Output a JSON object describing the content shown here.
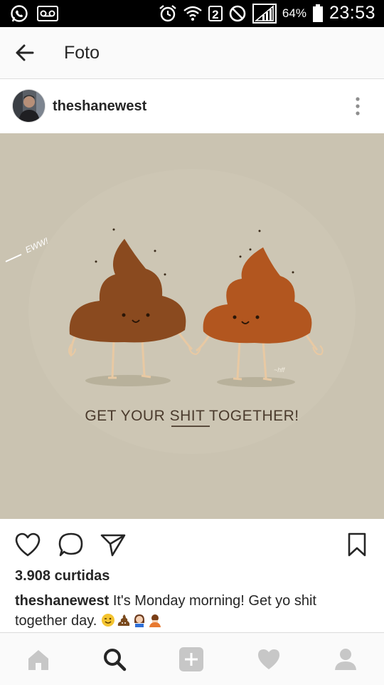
{
  "status_bar": {
    "sim_number": "2",
    "battery_percent": "64%",
    "time": "23:53",
    "icons": [
      "whatsapp-icon",
      "voicemail-icon",
      "alarm-icon",
      "wifi-icon",
      "no-signal-icon",
      "signal-icon",
      "battery-icon"
    ]
  },
  "app_bar": {
    "title": "Foto",
    "back_icon": "arrow-left-icon"
  },
  "post": {
    "username": "theshanewest",
    "image": {
      "headline_prefix": "GET YOUR ",
      "headline_emph": "SHIT",
      "headline_suffix": " TOGETHER!",
      "side_label": "EWW!",
      "signature": "~hff"
    },
    "likes": "3.908 curtidas",
    "caption_user": "theshanewest",
    "caption_text": " It's Monday morning! Get yo shit together day. ",
    "caption_emojis": [
      "winking-face-emoji",
      "pile-of-poo-emoji",
      "woman-emoji",
      "person-bowing-emoji"
    ]
  },
  "actions": [
    "heart-icon",
    "comment-icon",
    "send-icon",
    "bookmark-icon"
  ],
  "bottom_nav": [
    "home-icon",
    "search-icon",
    "add-icon",
    "activity-heart-icon",
    "profile-icon"
  ],
  "colors": {
    "image_bg": "#cac3b1",
    "poo_left": "#8a4a1f",
    "poo_right": "#b2561f",
    "text": "#262626",
    "status_bar": "#000000"
  }
}
